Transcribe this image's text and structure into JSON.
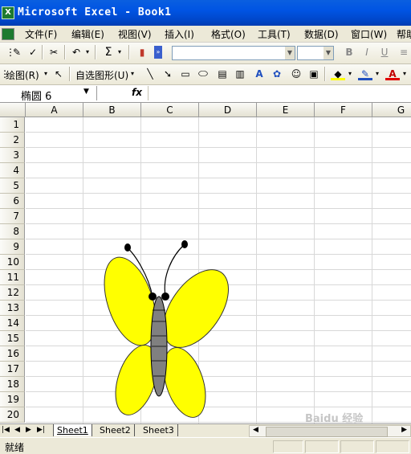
{
  "window": {
    "title": "Microsoft Excel - Book1",
    "app_icon": "X"
  },
  "menu": [
    "文件(F)",
    "编辑(E)",
    "视图(V)",
    "插入(I)",
    "格式(O)",
    "工具(T)",
    "数据(D)",
    "窗口(W)",
    "帮助"
  ],
  "drawing_toolbar": {
    "draw_label": "绘图(R)",
    "autoshape_label": "自选图形(U)"
  },
  "formula_bar": {
    "namebox": "椭圆 6",
    "fx": "fx"
  },
  "columns": [
    "A",
    "B",
    "C",
    "D",
    "E",
    "F",
    "G"
  ],
  "rows": [
    "1",
    "2",
    "3",
    "4",
    "5",
    "6",
    "7",
    "8",
    "9",
    "10",
    "11",
    "12",
    "13",
    "14",
    "15",
    "16",
    "17",
    "18",
    "19",
    "20"
  ],
  "sheets": [
    "Sheet1",
    "Sheet2",
    "Sheet3"
  ],
  "active_sheet": "Sheet1",
  "status": "就绪",
  "watermark": "Baidu 经验",
  "colors": {
    "wing": "#ffff00",
    "body": "#808080",
    "title_bar": "#0054e3"
  }
}
